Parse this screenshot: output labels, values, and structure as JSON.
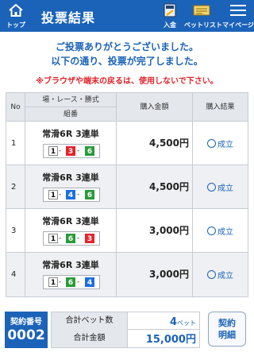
{
  "header": {
    "home_label": "トップ",
    "title": "投票結果",
    "deposit_label": "入金",
    "betlist_label": "ベットリスト",
    "mypage_label": "マイページ"
  },
  "messages": {
    "line1": "ご投票ありがとうございました。",
    "line2": "以下の通り、投票が完了しました。",
    "warning": "※ブラウザや端末の戻るは、使用しないで下さい。"
  },
  "table": {
    "headers": {
      "no": "No",
      "race_top": "場・レース・勝式",
      "race_bottom": "組番",
      "amount": "購入金額",
      "result": "購入結果"
    },
    "rows": [
      {
        "no": "1",
        "race": "常滑6R 3連単",
        "boats": [
          "1",
          "3",
          "6"
        ],
        "amount": "4,500円",
        "result": "成立"
      },
      {
        "no": "2",
        "race": "常滑6R 3連単",
        "boats": [
          "1",
          "4",
          "6"
        ],
        "amount": "4,500円",
        "result": "成立"
      },
      {
        "no": "3",
        "race": "常滑6R 3連単",
        "boats": [
          "1",
          "6",
          "3"
        ],
        "amount": "3,000円",
        "result": "成立"
      },
      {
        "no": "4",
        "race": "常滑6R 3連単",
        "boats": [
          "1",
          "6",
          "4"
        ],
        "amount": "3,000円",
        "result": "成立"
      }
    ],
    "separator": "-"
  },
  "boat_colors": {
    "1": {
      "bg": "#ffffff",
      "fg": "#111111",
      "border": "#888888"
    },
    "3": {
      "bg": "#e4232b",
      "fg": "#ffffff",
      "border": "#e4232b"
    },
    "4": {
      "bg": "#1c6ee0",
      "fg": "#ffffff",
      "border": "#1c6ee0"
    },
    "6": {
      "bg": "#2a9a3a",
      "fg": "#ffffff",
      "border": "#2a9a3a"
    }
  },
  "footer": {
    "contract_label": "契約番号",
    "contract_number": "0002",
    "total_bets_label": "合計ベット数",
    "total_bets_value": "4",
    "total_bets_unit": "ベット",
    "total_amount_label": "合計金額",
    "total_amount_value": "15,000",
    "total_amount_unit": "円",
    "detail_button_line1": "契約",
    "detail_button_line2": "明細"
  },
  "colors": {
    "brand_blue": "#1b63b8",
    "warning_red": "#e0242a",
    "header_gray": "#e4e7ec"
  }
}
